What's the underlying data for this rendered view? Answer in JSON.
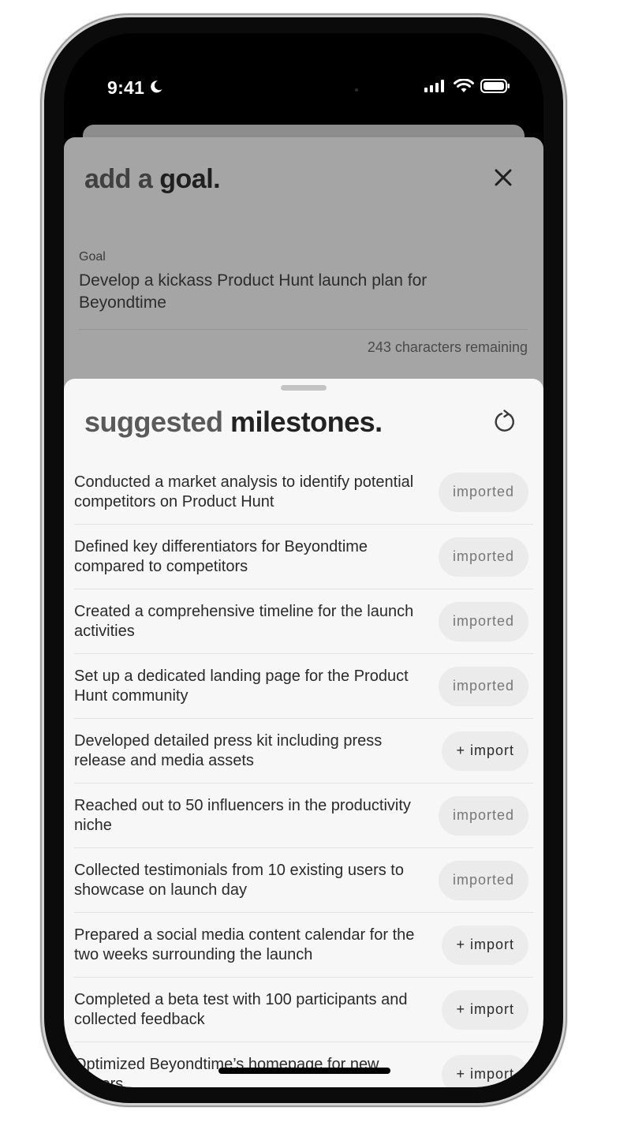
{
  "status": {
    "time": "9:41"
  },
  "goal_sheet": {
    "title_light": "add a ",
    "title_bold": "goal.",
    "field_label": "Goal",
    "field_value": "Develop a kickass Product Hunt launch plan for Beyondtime",
    "remaining": "243 characters remaining"
  },
  "milestones_sheet": {
    "title_light": "suggested ",
    "title_bold": "milestones.",
    "items": [
      {
        "text": "Conducted a market analysis to identify potential competitors on Product Hunt",
        "status": "imported"
      },
      {
        "text": "Defined key differentiators for Beyondtime compared to competitors",
        "status": "imported"
      },
      {
        "text": "Created a comprehensive timeline for the launch activities",
        "status": "imported"
      },
      {
        "text": "Set up a dedicated landing page for the Product Hunt community",
        "status": "imported"
      },
      {
        "text": "Developed detailed press kit including press release and media assets",
        "status": "+ import"
      },
      {
        "text": "Reached out to 50 influencers in the productivity niche",
        "status": "imported"
      },
      {
        "text": "Collected testimonials from 10 existing users to showcase on launch day",
        "status": "imported"
      },
      {
        "text": "Prepared a social media content calendar for the two weeks surrounding the launch",
        "status": "+ import"
      },
      {
        "text": "Completed a beta test with 100 participants and collected feedback",
        "status": "+ import"
      },
      {
        "text": "Optimized Beyondtime’s homepage for new visitors",
        "status": "+ import"
      }
    ]
  },
  "icons": {
    "close": "close-icon",
    "refresh": "refresh-icon",
    "moon": "moon-icon",
    "signal": "signal-icon",
    "wifi": "wifi-icon",
    "battery": "battery-icon"
  }
}
